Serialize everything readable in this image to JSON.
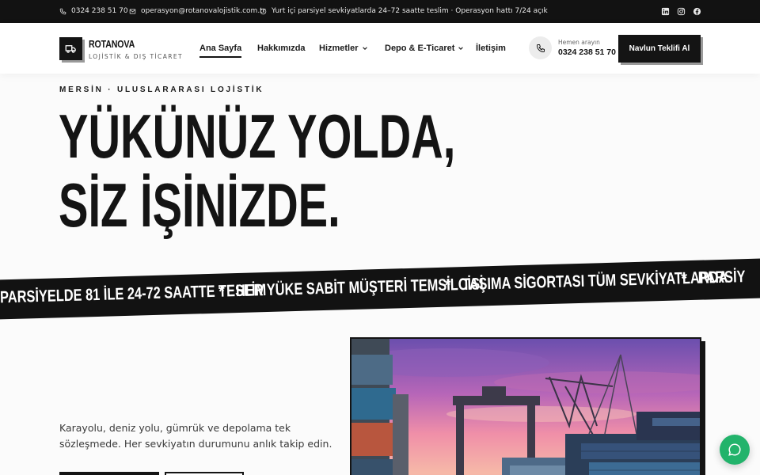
{
  "topbar": {
    "phone": "0324 238 51 70",
    "email": "operasyon@rotanovalojistik.com.tr",
    "notice": "Yurt içi parsiyel sevkiyatlarda 24–72 saatte teslim · Operasyon hattı 7/24 açık",
    "icons": [
      "phone-icon",
      "mail-icon",
      "clock-icon",
      "linkedin-icon",
      "instagram-icon",
      "facebook-icon"
    ]
  },
  "header": {
    "logo_name": "ROTANOVA",
    "logo_sub": "LOJİSTİK & DIŞ TİCARET",
    "nav": {
      "home": "Ana Sayfa",
      "about": "Hakkımızda",
      "services": "Hizmetler",
      "warehouse": "Depo & E-Ticaret",
      "contact": "İletişim"
    },
    "call_label": "Hemen arayın",
    "call_number": "0324 238 51 70",
    "cta": "Navlun Teklifi Al"
  },
  "hero": {
    "eyebrow": "MERSİN · ULUSLARARASI LOJİSTİK",
    "headline_1": "YÜKÜNÜZ YOLDA,",
    "headline_2": "SİZ İŞİNİZDE."
  },
  "marquee": {
    "item_1": "PARSİYELDE 81 İLE 24-72 SAATTE TESLİM",
    "item_2": "HER YÜKE SABİT MÜŞTERİ TEMSİLCİSİ",
    "item_3": "TAŞIMA SİGORTASI TÜM SEVKİYATLARDA",
    "item_4": "PARSİY",
    "separator": "*"
  },
  "intro": {
    "description": "Karayolu, deniz yolu, gümrük ve depolama tek sözleşmede. Her sevkiyatın durumunu anlık takip edin."
  },
  "colors": {
    "dark": "#141414",
    "chat": "#22b36b"
  }
}
